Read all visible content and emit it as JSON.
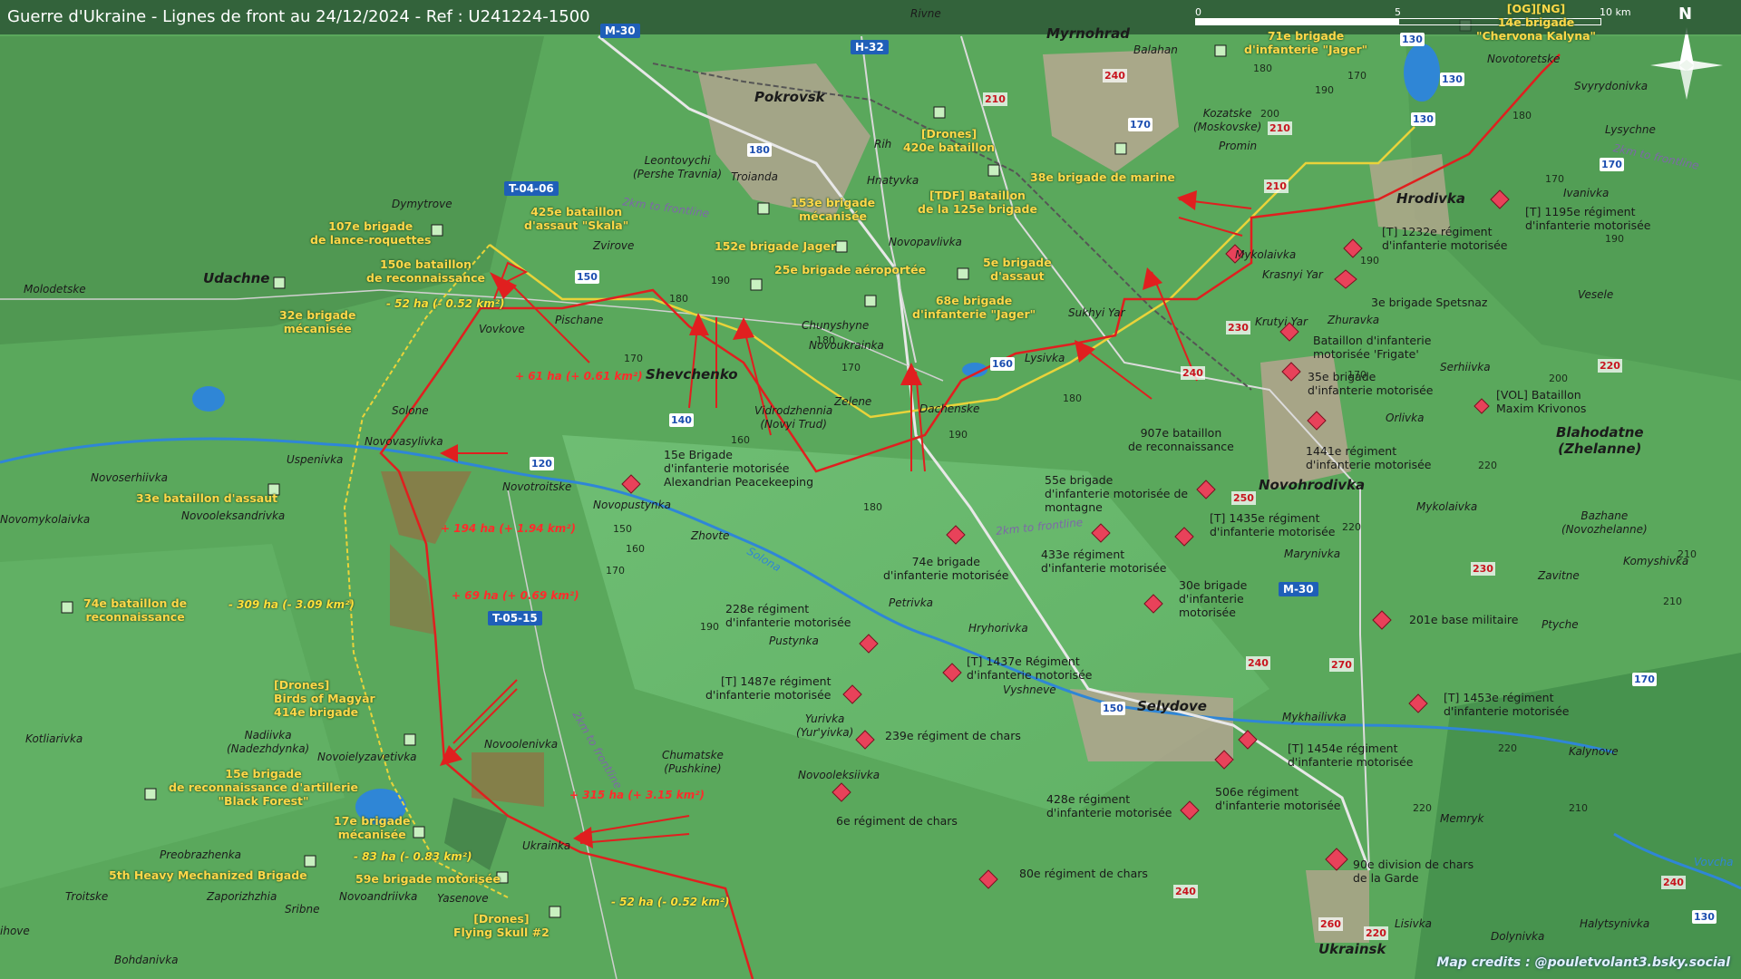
{
  "title": "Guerre d'Ukraine - Lignes de front au 24/12/2024 - Ref : U241224-1500",
  "scale": {
    "labels": [
      "0",
      "5",
      "10 km"
    ]
  },
  "north_label": "N",
  "credits": "Map credits : @pouletvolant3.bsky.social",
  "colors": {
    "terrain": "#5aa85c",
    "front_line": "#e01f1f",
    "ukrainian_units": "#ffd84a",
    "russian_units": "#e8425a",
    "river": "#2f86d6",
    "road_sign": "#1f5fb8"
  },
  "places": {
    "pokrovsk": "Pokrovsk",
    "myrnohrad": "Myrnohrad",
    "rivne": "Rivne",
    "balahan": "Balahan",
    "shevchenko": "Shevchenko",
    "udachne": "Udachne",
    "molodetske": "Molodetske",
    "dymytrove": "Dymytrove",
    "leontovychi": "Leontovychi\n(Pershe Travnia)",
    "troianda": "Troianda",
    "rih": "Rih",
    "hnatyvka": "Hnatyvka",
    "novopavlivka": "Novopavlivka",
    "zvirove": "Zvirove",
    "vovkove": "Vovkove",
    "pischane": "Pischane",
    "chunyshyne": "Chunyshyne",
    "novoukrainka": "Novoukrainka",
    "zelene": "Zelene",
    "dachenske": "Dachenske",
    "vidrodzhennia": "Vidrodzhennia\n(Novyi Trud)",
    "lysivka": "Lysivka",
    "sukhyi_yar": "Sukhyi Yar",
    "solone": "Solone",
    "novovasylivka": "Novovasylivka",
    "uspenivka": "Uspenivka",
    "novoserhiivka": "Novoserhiivka",
    "novomykolaivka": "Novomykolaivka",
    "novotroitske": "Novotroitske",
    "novooleksandrivka": "Novooleksandrivka",
    "novopustynka": "Novopustynka",
    "zhovte": "Zhovte",
    "petrivka": "Petrivka",
    "hryhorivka": "Hryhorivka",
    "pustynka": "Pustynka",
    "vyshneve": "Vyshneve",
    "yurivka": "Yurivka\n(Yur'yivka)",
    "novooleksiivka": "Novooleksiivka",
    "chumatske": "Chumatske\n(Pushkine)",
    "selydove": "Selydove",
    "mykhailivka": "Mykhailivka",
    "kotliarivka": "Kotliarivka",
    "nadiivka": "Nadiivka\n(Nadezhdynka)",
    "novoielyzavetivka": "Novoielyzavetivka",
    "novoolenivka": "Novoolenivka",
    "ukrainka": "Ukrainka",
    "preobrazhenka": "Preobrazhenka",
    "troitske": "Troitske",
    "zaporizhzhia": "Zaporizhzhia",
    "novoandriivka": "Novoandriivka",
    "yasenove": "Yasenove",
    "sribne": "Sribne",
    "bohdanivka": "Bohdanivka",
    "ihove": "ihove",
    "novohrodivka": "Novohrodivka",
    "hrodivka": "Hrodivka",
    "novotoretske": "Novotoretske",
    "svyrydonivka": "Svyrydonivka",
    "lysychne": "Lysychne",
    "ivanivka": "Ivanivka",
    "kozatske": "Kozatske\n(Moskovske)",
    "promin": "Promin",
    "mykolaivka": "Mykolaivka",
    "krasnyi_yar": "Krasnyi Yar",
    "krutyi_yar": "Krutyi Yar",
    "zhuravka": "Zhuravka",
    "veselе": "Vesele",
    "serhiivka": "Serhiivka",
    "orlivka": "Orlivka",
    "blahodatne": "Blahodatne\n(Zhelanne)",
    "mykolaivka2": "Mykolaivka",
    "bazhane": "Bazhane\n(Novozhelanne)",
    "marynivka": "Marynivka",
    "zavitne": "Zavitne",
    "komyshivka": "Komyshivka",
    "ptychе": "Ptyche",
    "kalynove": "Kalynove",
    "memryk": "Memryk",
    "lisivka": "Lisivka",
    "dolynivka": "Dolynivka",
    "halytsynivka": "Halytsynivka",
    "ukrainsk": "Ukrainsk",
    "vovcha": "Vovcha",
    "solona": "Solona"
  },
  "road_signs": [
    "M-30",
    "H-32",
    "T-04-06",
    "T-05-15",
    "M-30"
  ],
  "routes": [
    "130",
    "130",
    "130",
    "180",
    "150",
    "140",
    "120",
    "160",
    "170",
    "170",
    "150",
    "170",
    "130"
  ],
  "altitudes_red": [
    "240",
    "210",
    "210",
    "210",
    "230",
    "240",
    "250",
    "230",
    "220",
    "240",
    "270",
    "240",
    "260",
    "220",
    "240"
  ],
  "altitudes": [
    "180",
    "190",
    "170",
    "200",
    "190",
    "180",
    "170",
    "190",
    "180",
    "170",
    "160",
    "180",
    "190",
    "170",
    "150",
    "160",
    "170",
    "190",
    "180",
    "210",
    "220",
    "200",
    "220",
    "210",
    "220",
    "220",
    "210",
    "190",
    "180",
    "170"
  ],
  "frontline_labels": [
    "2km to frontline",
    "2km to frontline",
    "2km to frontline",
    "2km to frontline"
  ],
  "ukrainian_units": [
    "[OG][NG]\n14e brigade\n\"Chervona Kalyna\"",
    "71e brigade\nd'infanterie \"Jager\"",
    "[Drones]\n420e bataillon",
    "38e brigade de marine",
    "[TDF] Bataillon\nde la 125e brigade",
    "153e brigade\nmécanisée",
    "425e bataillon\nd'assaut \"Skala\"",
    "152e brigade Jager",
    "25e brigade aéroportée",
    "5e brigade\nd'assaut",
    "68e brigade\nd'infanterie \"Jager\"",
    "107e brigade\nde lance-roquettes",
    "150e bataillon\nde reconnaissance",
    "32e brigade\nmécanisée",
    "33e bataillon d'assaut",
    "74e bataillon de\nreconnaissance",
    "[Drones]\nBirds of Magyar\n414e brigade",
    "15e brigade\nde reconnaissance d'artillerie\n\"Black Forest\"",
    "17e brigade\nmécanisée",
    "5th Heavy Mechanized Brigade",
    "59e brigade motorisée",
    "[Drones]\nFlying Skull #2"
  ],
  "russian_units": [
    "[T] 1232e régiment\nd'infanterie motorisée",
    "[T] 1195e régiment\nd'infanterie motorisée",
    "3e brigade Spetsnaz",
    "Bataillon d'infanterie\nmotorisée 'Frigate'",
    "35e brigade\nd'infanterie motorisée",
    "[VOL] Bataillon\nMaxim Krivonos",
    "907e bataillon\nde reconnaissance",
    "1441e régiment\nd'infanterie motorisée",
    "55e brigade\nd'infanterie motorisée de\nmontagne",
    "[T] 1435e régiment\nd'infanterie motorisée",
    "433e régiment\nd'infanterie motorisée",
    "30e brigade\nd'infanterie\nmotorisée",
    "201e base militaire",
    "15e Brigade\nd'infanterie motorisée\nAlexandrian Peacekeeping",
    "74e brigade\nd'infanterie motorisée",
    "228e régiment\nd'infanterie motorisée",
    "[T] 1437e Régiment\nd'infanterie motorisée",
    "[T] 1487e régiment\nd'infanterie motorisée",
    "239e régiment de chars",
    "6e régiment de chars",
    "428e régiment\nd'infanterie motorisée",
    "506e régiment\nd'infanterie motorisée",
    "[T] 1454e régiment\nd'infanterie motorisée",
    "[T] 1453e régiment\nd'infanterie motorisée",
    "80e régiment de chars",
    "90e division de chars\nde la Garde"
  ],
  "area_changes": {
    "gains": [
      "+ 61 ha (+ 0.61 km²)",
      "+ 194 ha (+ 1.94 km²)",
      "+ 69 ha (+ 0.69 km²)",
      "+ 315 ha (+ 3.15 km²)"
    ],
    "losses": [
      "- 52 ha (- 0.52 km²)",
      "- 309 ha (- 3.09 km²)",
      "- 83 ha (- 0.83 km²)",
      "- 52 ha (- 0.52 km²)"
    ]
  }
}
